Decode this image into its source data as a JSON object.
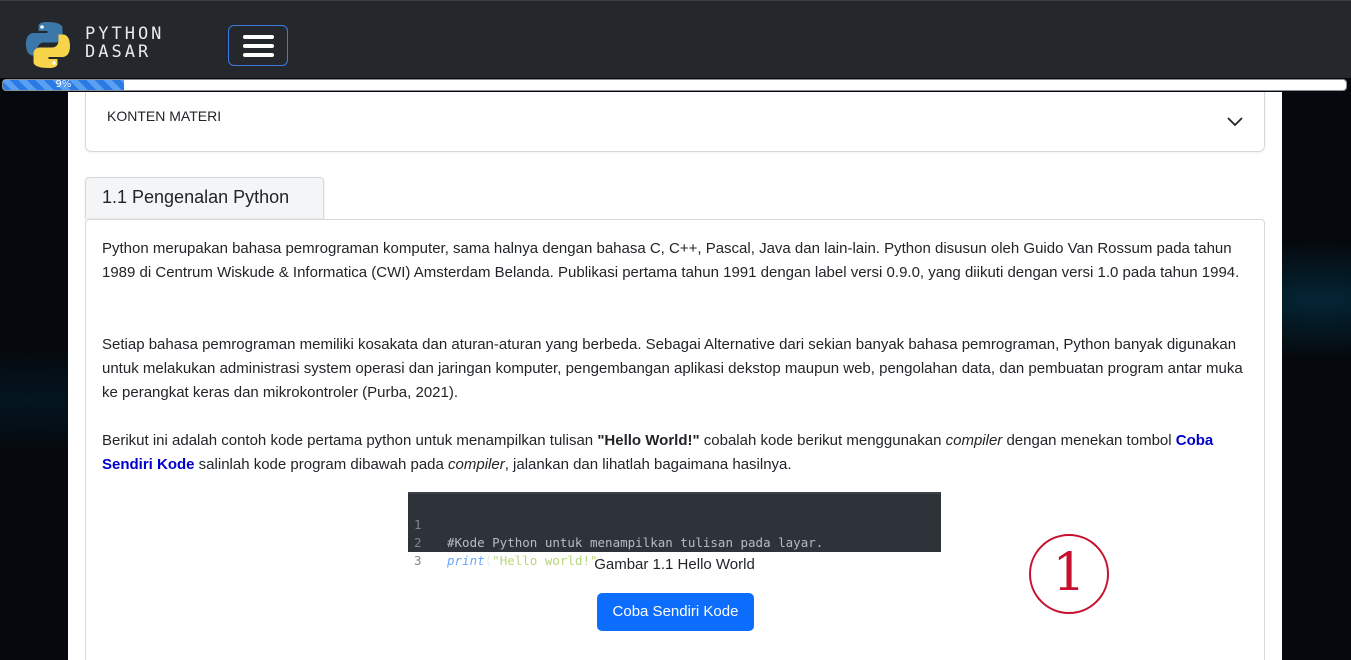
{
  "navbar": {
    "brand_line1": "PYTHON",
    "brand_line2": "DASAR",
    "logo_icon": "python-logo-icon",
    "menu_icon": "hamburger-menu-icon"
  },
  "progress": {
    "label": "9%",
    "value": 0.09
  },
  "accordion": {
    "title": "KONTEN MATERI",
    "icon": "chevron-down-icon"
  },
  "section": {
    "tab_title": "1.1 Pengenalan Python",
    "para1": "Python merupakan bahasa pemrograman komputer, sama halnya dengan bahasa C, C++, Pascal, Java dan lain-lain. Python disusun oleh Guido Van Rossum pada tahun 1989 di Centrum Wiskude & Informatica (CWI) Amsterdam Belanda. Publikasi pertama tahun 1991 dengan label versi 0.9.0, yang diikuti dengan versi 1.0 pada tahun 1994.",
    "para2": "Setiap bahasa pemrograman memiliki kosakata dan aturan-aturan yang berbeda. Sebagai Alternative dari sekian banyak bahasa pemrograman, Python banyak digunakan untuk melakukan administrasi system operasi dan jaringan komputer, pengembangan aplikasi dekstop maupun web, pengolahan data, dan pembuatan program antar muka ke perangkat keras dan mikrokontroler (Purba, 2021).",
    "para3": {
      "t1": "Berikut ini adalah contoh kode pertama python untuk menampilkan tulisan ",
      "b1": "\"Hello World!\"",
      "t2": " cobalah kode berikut menggunakan ",
      "i1": "compiler",
      "t3": " dengan menekan tombol ",
      "link": "Coba Sendiri Kode",
      "t4": " salinlah kode program dibawah pada ",
      "i2": "compiler",
      "t5": ", jalankan dan lihatlah bagaimana hasilnya."
    },
    "code": {
      "line_numbers": [
        "1",
        "2",
        "3"
      ],
      "comment": "#Kode Python untuk menampilkan tulisan pada layar.",
      "fn": "print",
      "open": "(",
      "str": "\"Hello world!\"",
      "close": ")"
    },
    "caption": "Gambar 1.1 Hello World",
    "button_label": "Coba Sendiri Kode"
  },
  "annotation": {
    "marker": "1"
  },
  "colors": {
    "navbar": "#24272b",
    "accent": "#0d6efd",
    "link": "#0000cc",
    "marker": "#c8102e"
  }
}
